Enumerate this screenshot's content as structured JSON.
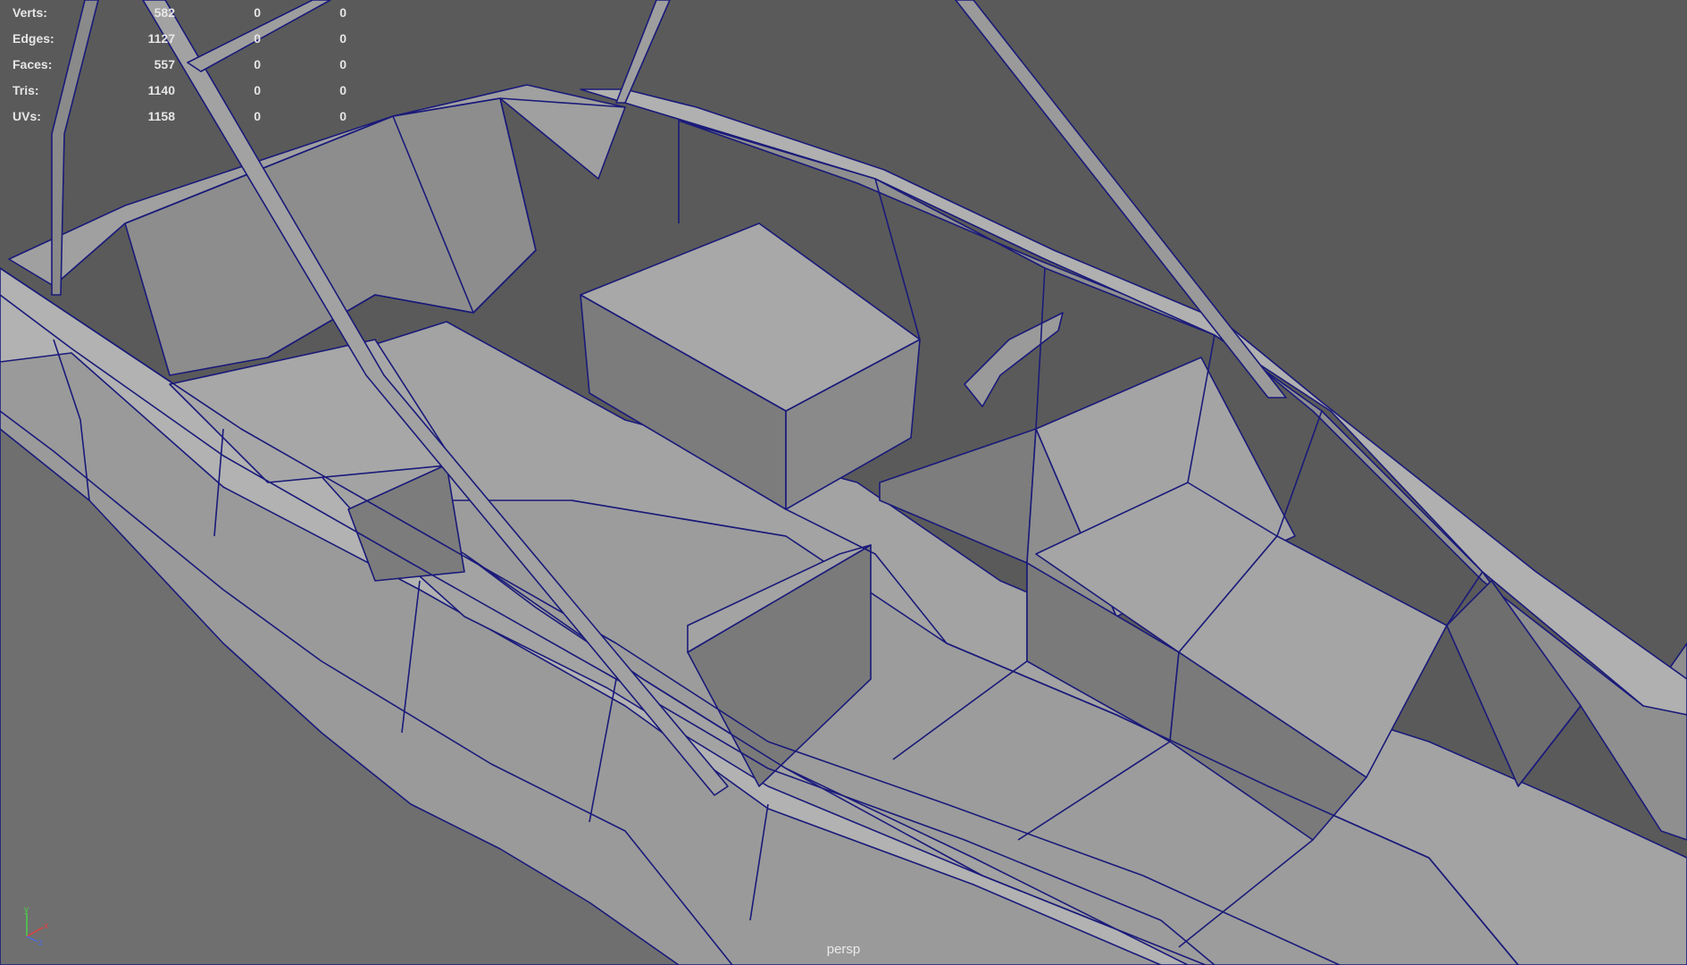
{
  "hud": {
    "rows": [
      {
        "label": "Verts:",
        "value": "582",
        "selected": "0",
        "uv": "0"
      },
      {
        "label": "Edges:",
        "value": "1127",
        "selected": "0",
        "uv": "0"
      },
      {
        "label": "Faces:",
        "value": "557",
        "selected": "0",
        "uv": "0"
      },
      {
        "label": "Tris:",
        "value": "1140",
        "selected": "0",
        "uv": "0"
      },
      {
        "label": "UVs:",
        "value": "1158",
        "selected": "0",
        "uv": "0"
      }
    ]
  },
  "camera": {
    "name": "persp"
  },
  "axis": {
    "x": "x",
    "y": "y",
    "z": "z"
  },
  "colors": {
    "background": "#5a5a5a",
    "wire": "#1a1a7a",
    "face_light": "#a6a6a6",
    "face_mid": "#939393",
    "face_dark": "#777777"
  }
}
